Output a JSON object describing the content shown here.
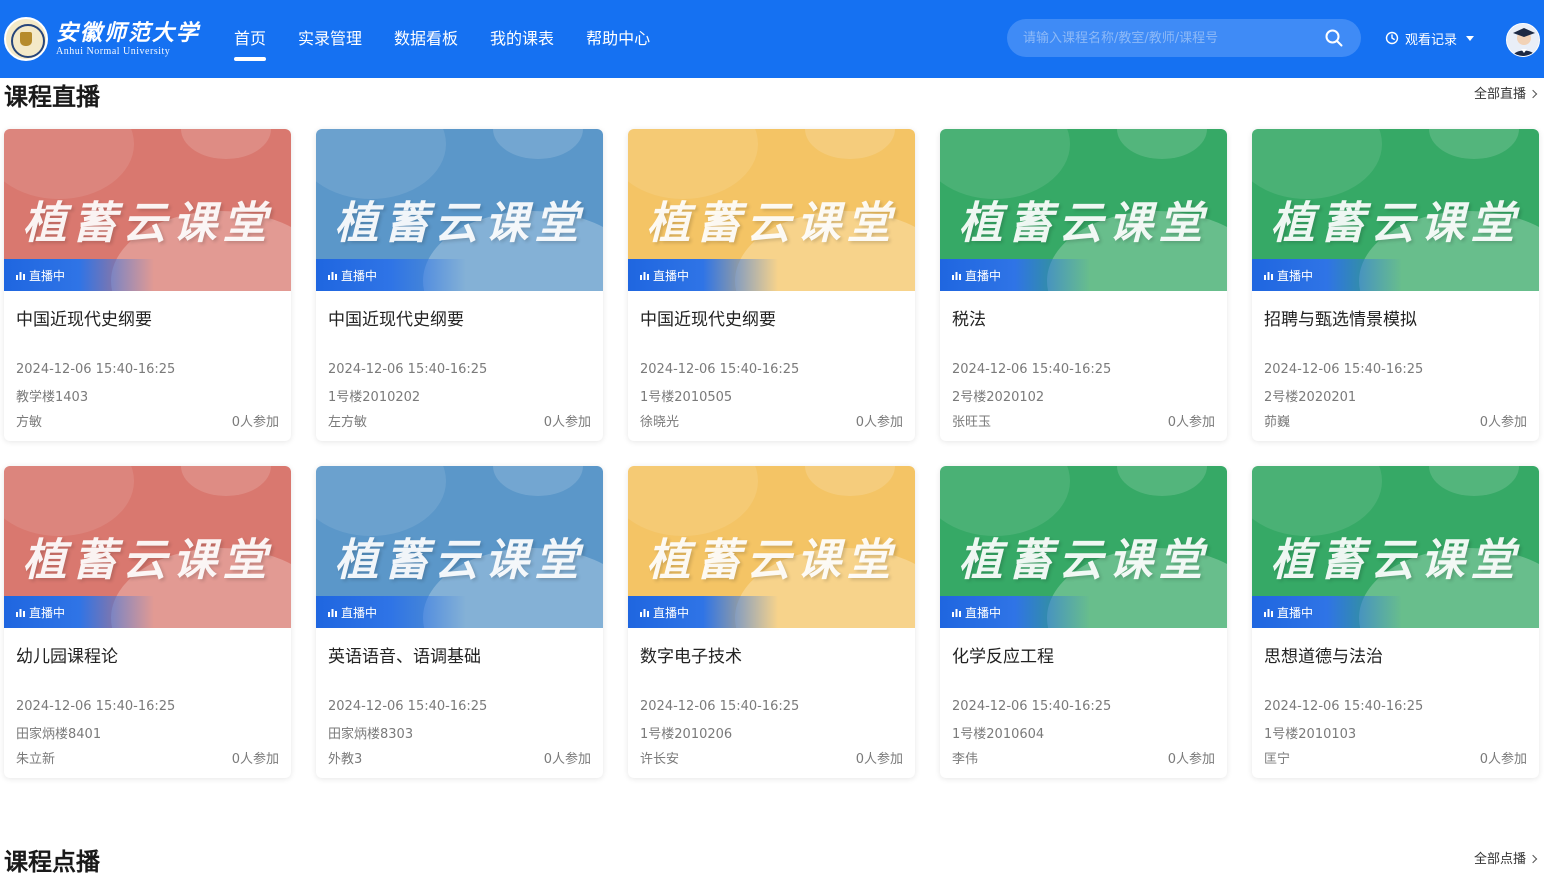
{
  "header": {
    "logo_cn": "安徽师范大学",
    "logo_en": "Anhui Normal University",
    "nav": [
      {
        "label": "首页",
        "active": true
      },
      {
        "label": "实录管理",
        "active": false
      },
      {
        "label": "数据看板",
        "active": false
      },
      {
        "label": "我的课表",
        "active": false
      },
      {
        "label": "帮助中心",
        "active": false
      }
    ],
    "search_placeholder": "请输入课程名称/教室/教师/课程号",
    "history_label": "观看记录",
    "search_icon": "search-icon",
    "history_icon": "clock-icon"
  },
  "live_section": {
    "title": "课程直播",
    "more": "全部直播",
    "banner_text": "植蓄云课堂",
    "badge": "直播中",
    "courses": [
      {
        "name": "中国近现代史纲要",
        "time": "2024-12-06 15:40-16:25",
        "room": "教学楼1403",
        "teacher": "方敏",
        "count": "0人参加",
        "theme": "red"
      },
      {
        "name": "中国近现代史纲要",
        "time": "2024-12-06 15:40-16:25",
        "room": "1号楼2010202",
        "teacher": "左方敏",
        "count": "0人参加",
        "theme": "blue"
      },
      {
        "name": "中国近现代史纲要",
        "time": "2024-12-06 15:40-16:25",
        "room": "1号楼2010505",
        "teacher": "徐晓光",
        "count": "0人参加",
        "theme": "yellow"
      },
      {
        "name": "税法",
        "time": "2024-12-06 15:40-16:25",
        "room": "2号楼2020102",
        "teacher": "张旺玉",
        "count": "0人参加",
        "theme": "green"
      },
      {
        "name": "招聘与甄选情景模拟",
        "time": "2024-12-06 15:40-16:25",
        "room": "2号楼2020201",
        "teacher": "茆巍",
        "count": "0人参加",
        "theme": "green"
      },
      {
        "name": "幼儿园课程论",
        "time": "2024-12-06 15:40-16:25",
        "room": "田家炳楼8401",
        "teacher": "朱立新",
        "count": "0人参加",
        "theme": "red"
      },
      {
        "name": "英语语音、语调基础",
        "time": "2024-12-06 15:40-16:25",
        "room": "田家炳楼8303",
        "teacher": "外教3",
        "count": "0人参加",
        "theme": "blue"
      },
      {
        "name": "数字电子技术",
        "time": "2024-12-06 15:40-16:25",
        "room": "1号楼2010206",
        "teacher": "许长安",
        "count": "0人参加",
        "theme": "yellow"
      },
      {
        "name": "化学反应工程",
        "time": "2024-12-06 15:40-16:25",
        "room": "1号楼2010604",
        "teacher": "李伟",
        "count": "0人参加",
        "theme": "green"
      },
      {
        "name": "思想道德与法治",
        "time": "2024-12-06 15:40-16:25",
        "room": "1号楼2010103",
        "teacher": "匡宁",
        "count": "0人参加",
        "theme": "green"
      }
    ]
  },
  "vod_section": {
    "title": "课程点播",
    "more": "全部点播"
  },
  "colors": {
    "header_bg": "#1571f2",
    "accent": "#1f66e0",
    "red": "#d9786f",
    "blue": "#5b97c9",
    "yellow": "#f4c465",
    "green": "#36a966"
  }
}
